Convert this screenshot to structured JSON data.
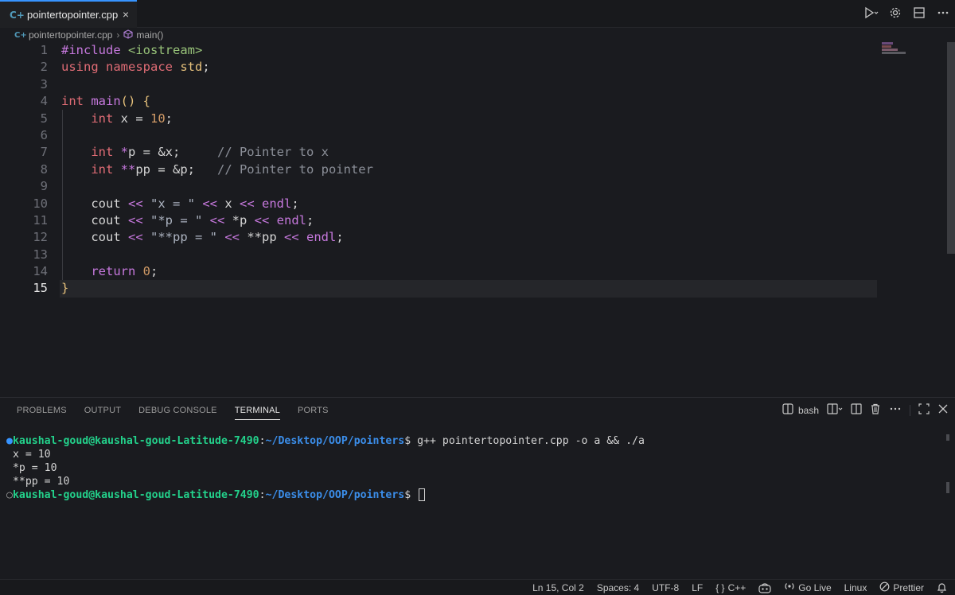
{
  "tab": {
    "filename": "pointertopointer.cpp",
    "icon": "cpp-file-icon",
    "close": "×"
  },
  "breadcrumb": {
    "file": "pointertopointer.cpp",
    "symbol": "main()"
  },
  "editor": {
    "active_line": 15,
    "line_numbers": [
      "1",
      "2",
      "3",
      "4",
      "5",
      "6",
      "7",
      "8",
      "9",
      "10",
      "11",
      "12",
      "13",
      "14",
      "15"
    ],
    "lines": [
      [
        {
          "t": "#include ",
          "c": "pre"
        },
        {
          "t": "<iostream>",
          "c": "inc"
        }
      ],
      [
        {
          "t": "using ",
          "c": "kw"
        },
        {
          "t": "namespace ",
          "c": "kw"
        },
        {
          "t": "std",
          "c": "ns"
        },
        {
          "t": ";",
          "c": "punc"
        }
      ],
      [],
      [
        {
          "t": "int ",
          "c": "kw"
        },
        {
          "t": "main",
          "c": "fn"
        },
        {
          "t": "() ",
          "c": "brace"
        },
        {
          "t": "{",
          "c": "brace"
        }
      ],
      [
        {
          "t": "    "
        },
        {
          "t": "int ",
          "c": "kw"
        },
        {
          "t": "x = ",
          "c": "var"
        },
        {
          "t": "10",
          "c": "num"
        },
        {
          "t": ";",
          "c": "punc"
        }
      ],
      [],
      [
        {
          "t": "    "
        },
        {
          "t": "int ",
          "c": "kw"
        },
        {
          "t": "*",
          "c": "op"
        },
        {
          "t": "p = &x;     ",
          "c": "var"
        },
        {
          "t": "// Pointer to x",
          "c": "cmt"
        }
      ],
      [
        {
          "t": "    "
        },
        {
          "t": "int ",
          "c": "kw"
        },
        {
          "t": "**",
          "c": "op"
        },
        {
          "t": "pp = &p;   ",
          "c": "var"
        },
        {
          "t": "// Pointer to pointer",
          "c": "cmt"
        }
      ],
      [],
      [
        {
          "t": "    cout ",
          "c": "var"
        },
        {
          "t": "<< ",
          "c": "op"
        },
        {
          "t": "\"x = \" ",
          "c": "str"
        },
        {
          "t": "<< ",
          "c": "op"
        },
        {
          "t": "x ",
          "c": "var"
        },
        {
          "t": "<< ",
          "c": "op"
        },
        {
          "t": "endl",
          "c": "endl"
        },
        {
          "t": ";",
          "c": "punc"
        }
      ],
      [
        {
          "t": "    cout ",
          "c": "var"
        },
        {
          "t": "<< ",
          "c": "op"
        },
        {
          "t": "\"*p = \" ",
          "c": "str"
        },
        {
          "t": "<< ",
          "c": "op"
        },
        {
          "t": "*p ",
          "c": "var"
        },
        {
          "t": "<< ",
          "c": "op"
        },
        {
          "t": "endl",
          "c": "endl"
        },
        {
          "t": ";",
          "c": "punc"
        }
      ],
      [
        {
          "t": "    cout ",
          "c": "var"
        },
        {
          "t": "<< ",
          "c": "op"
        },
        {
          "t": "\"**pp = \" ",
          "c": "str"
        },
        {
          "t": "<< ",
          "c": "op"
        },
        {
          "t": "**pp ",
          "c": "var"
        },
        {
          "t": "<< ",
          "c": "op"
        },
        {
          "t": "endl",
          "c": "endl"
        },
        {
          "t": ";",
          "c": "punc"
        }
      ],
      [],
      [
        {
          "t": "    "
        },
        {
          "t": "return ",
          "c": "ret"
        },
        {
          "t": "0",
          "c": "num"
        },
        {
          "t": ";",
          "c": "punc"
        }
      ],
      [
        {
          "t": "}",
          "c": "brace"
        }
      ]
    ]
  },
  "panel": {
    "tabs": [
      "PROBLEMS",
      "OUTPUT",
      "DEBUG CONSOLE",
      "TERMINAL",
      "PORTS"
    ],
    "active_tab": "TERMINAL",
    "shell": "bash"
  },
  "terminal": {
    "user_host": "kaushal-goud@kaushal-goud-Latitude-7490",
    "path": "~/Desktop/OOP/pointers",
    "command": "g++ pointertopointer.cpp -o a && ./a",
    "output": [
      "x = 10",
      "*p = 10",
      "**pp = 10"
    ],
    "prompt_suffix": "$ "
  },
  "statusbar": {
    "position": "Ln 15, Col 2",
    "spaces": "Spaces: 4",
    "encoding": "UTF-8",
    "eol": "LF",
    "language": "C++",
    "language_icon": "{ }",
    "go_live": "Go Live",
    "platform": "Linux",
    "prettier": "Prettier"
  },
  "colors": {
    "accent": "#3794ff",
    "terminal_user": "#23d18b",
    "terminal_path": "#3b8eea"
  }
}
